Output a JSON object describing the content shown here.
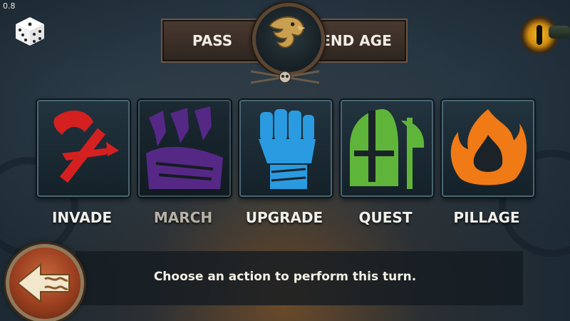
{
  "version": "0.8",
  "top_bar": {
    "pass_label": "PASS",
    "end_age_label": "END AGE"
  },
  "icons": {
    "dice": "dice-icon",
    "emblem": "eagle-emblem-icon",
    "eye": "eye-icon",
    "back": "back-arrow-shield-icon"
  },
  "actions": [
    {
      "label": "INVADE",
      "icon": "axe-icon",
      "color": "#d42020"
    },
    {
      "label": "MARCH",
      "icon": "march-icon",
      "color": "#6a32a8"
    },
    {
      "label": "UPGRADE",
      "icon": "fist-icon",
      "color": "#2a9be0"
    },
    {
      "label": "QUEST",
      "icon": "helmet-axe-icon",
      "color": "#5fb53a"
    },
    {
      "label": "PILLAGE",
      "icon": "fire-icon",
      "color": "#f07a16"
    }
  ],
  "message": "Choose an action to perform this turn.",
  "colors": {
    "accent_gold": "#c9a050",
    "text_light": "#f0f0ec"
  }
}
